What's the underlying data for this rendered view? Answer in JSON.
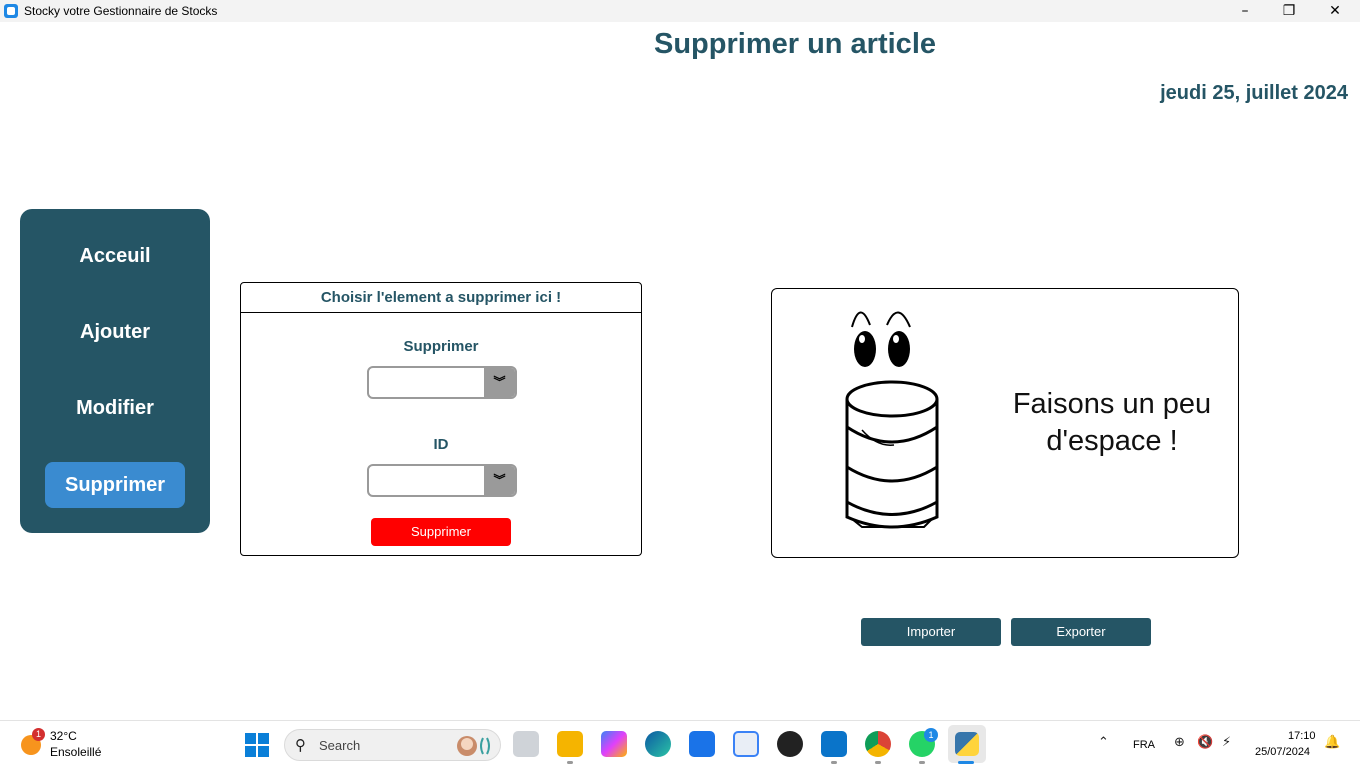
{
  "window": {
    "title": "Stocky votre Gestionnaire de Stocks",
    "minimize_icon": "–",
    "maximize_icon": "❐",
    "close_icon": "✕"
  },
  "header": {
    "title": "Supprimer un article",
    "date": "jeudi 25, juillet 2024"
  },
  "sidebar": {
    "items": [
      {
        "label": "Acceuil",
        "active": false
      },
      {
        "label": "Ajouter",
        "active": false
      },
      {
        "label": "Modifier",
        "active": false
      },
      {
        "label": "Supprimer",
        "active": true
      }
    ]
  },
  "form": {
    "header": "Choisir l'element a supprimer ici !",
    "supprimer_label": "Supprimer",
    "supprimer_value": "",
    "id_label": "ID",
    "id_value": "",
    "dropdown_arrow": "︾",
    "delete_button": "Supprimer"
  },
  "illustration": {
    "slogan_line1": "Faisons un peu",
    "slogan_line2": "d'espace !"
  },
  "actions": {
    "import_button": "Importer",
    "export_button": "Exporter"
  },
  "taskbar": {
    "weather_badge": "1",
    "weather_temp": "32°C",
    "weather_condition": "Ensoleillé",
    "search_placeholder": "Search",
    "search_glyph": "⚲",
    "whatsapp_badge": "1",
    "tray_chevron": "⌃",
    "language": "FRA",
    "network_glyph": "⊕",
    "volume_glyph": "🔇",
    "battery_glyph": "⚡",
    "time": "17:10",
    "date": "25/07/2024",
    "notification_glyph": "🔔"
  },
  "colors": {
    "primary": "#255565",
    "active_nav": "#3a8bd0",
    "danger": "#ff0000"
  }
}
